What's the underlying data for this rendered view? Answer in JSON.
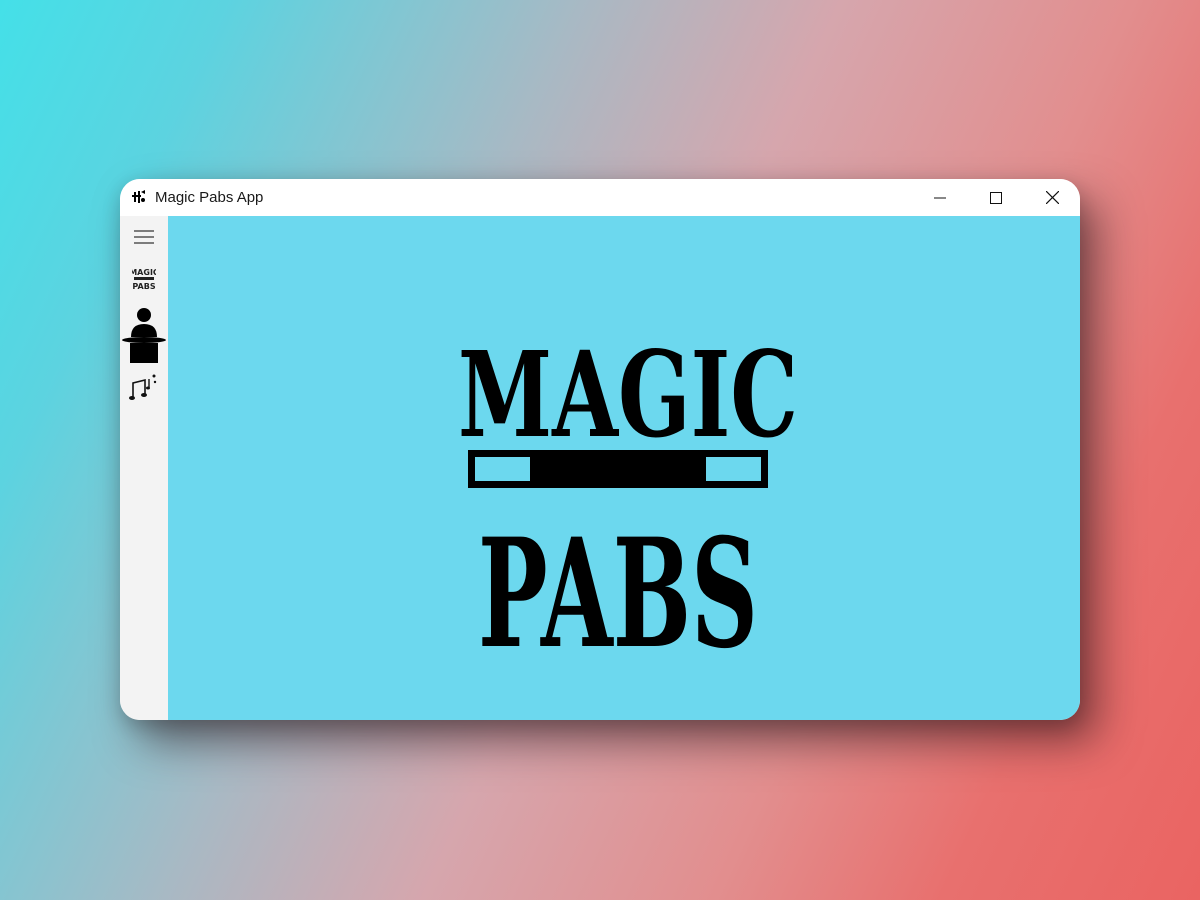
{
  "window": {
    "title": "Magic Pabs App",
    "controls": {
      "minimize_icon": "minimize-icon",
      "maximize_icon": "maximize-icon",
      "close_icon": "close-icon"
    }
  },
  "sidebar": {
    "items": [
      {
        "icon": "hamburger-menu-icon"
      },
      {
        "icon": "magic-pabs-logo-icon",
        "label": "MAGIC PABS"
      },
      {
        "icon": "magician-icon"
      },
      {
        "icon": "music-notes-icon"
      }
    ]
  },
  "main": {
    "logo": {
      "line1": "MAGIC",
      "line2": "PABS"
    }
  },
  "colors": {
    "content_bg": "#6cd8ee",
    "sidebar_bg": "#f3f3f3",
    "logo_ink": "#000000"
  }
}
